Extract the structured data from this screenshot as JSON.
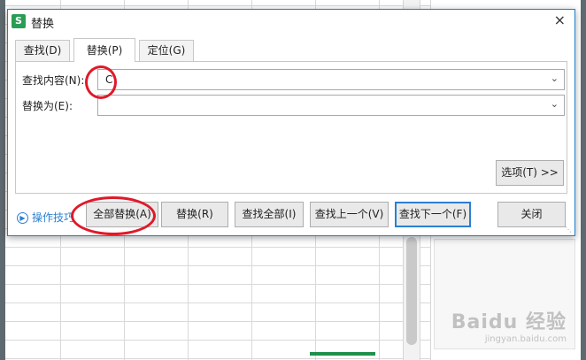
{
  "dialog": {
    "title": "替换",
    "app_icon_letter": "S",
    "close_glyph": "×"
  },
  "tabs": [
    {
      "label": "查找(D)",
      "active": false
    },
    {
      "label": "替换(P)",
      "active": true
    },
    {
      "label": "定位(G)",
      "active": false
    }
  ],
  "find": {
    "label": "查找内容(N):",
    "value": "C"
  },
  "replace": {
    "label": "替换为(E):",
    "value": ""
  },
  "options_button": "选项(T) >>",
  "ops_tips": "操作技巧",
  "buttons": {
    "replace_all": "全部替换(A)",
    "replace": "替换(R)",
    "find_all": "查找全部(I)",
    "find_prev": "查找上一个(V)",
    "find_next": "查找下一个(F)",
    "close": "关闭"
  },
  "watermark": {
    "main": "Baidu 经验",
    "sub": "jingyan.baidu.com"
  },
  "colors": {
    "accent": "#2b7fd2",
    "annotation": "#e0192a",
    "app_icon": "#2a9d55"
  }
}
